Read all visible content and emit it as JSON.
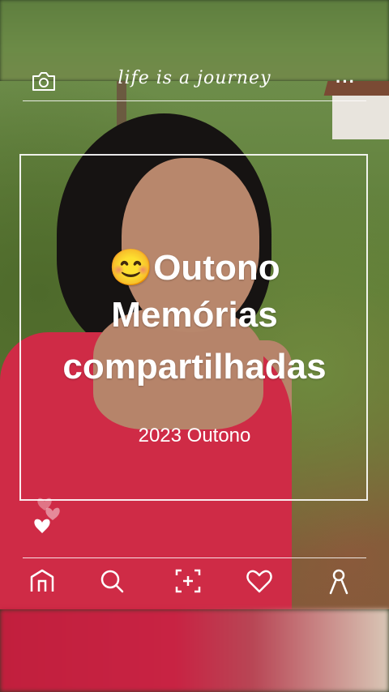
{
  "header": {
    "caption": "life is a journey",
    "more_label": "···"
  },
  "card": {
    "emoji": "😊",
    "line1": "Outono",
    "line2": "Memórias",
    "line3": "compartilhadas",
    "year_label": "2023 Outono"
  },
  "nav": {
    "items": [
      "home-icon",
      "search-icon",
      "add-photo-icon",
      "heart-icon",
      "profile-icon"
    ]
  },
  "colors": {
    "accent_shirt": "#cf2b46",
    "overlay": "#ffffff"
  }
}
